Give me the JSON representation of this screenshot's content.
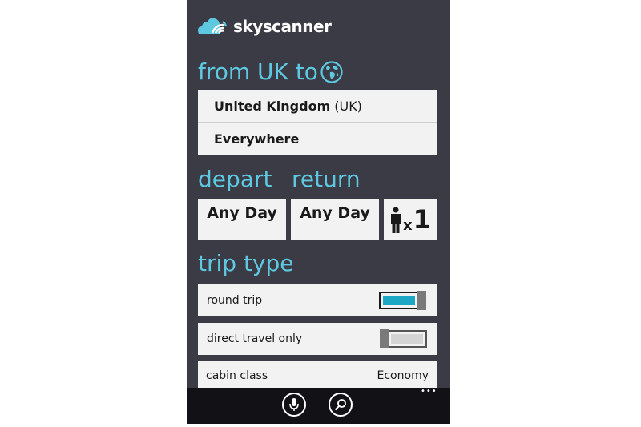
{
  "app": {
    "logo_text": "skyscanner"
  },
  "route": {
    "title": "from UK to",
    "origin": {
      "name": "United Kingdom",
      "code": "(UK)"
    },
    "destination": "Everywhere"
  },
  "dates": {
    "depart_label": "depart",
    "return_label": "return",
    "depart_value": "Any Day",
    "return_value": "Any Day",
    "passengers_prefix": "x",
    "passengers_count": "1"
  },
  "trip_type": {
    "title": "trip type",
    "round_trip": {
      "label": "round trip",
      "on": true
    },
    "direct_only": {
      "label": "direct travel only",
      "on": false
    },
    "cabin": {
      "label": "cabin class",
      "value": "Economy"
    }
  },
  "appbar": {
    "more": "•••"
  },
  "colors": {
    "accent": "#5ec8e0",
    "toggle_on": "#1ea7c4",
    "background": "#3b3b46"
  }
}
